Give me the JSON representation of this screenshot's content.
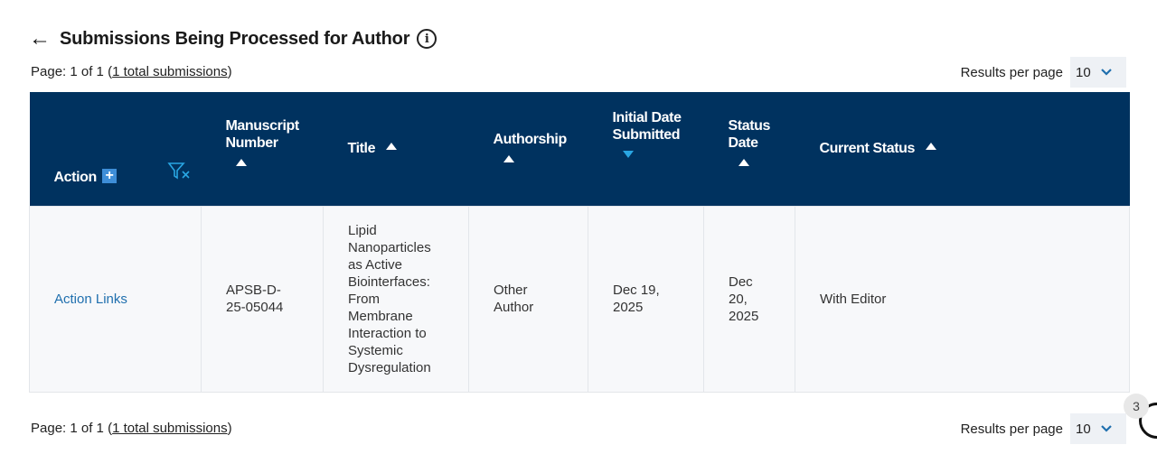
{
  "header": {
    "title": "Submissions Being Processed for Author",
    "back_icon": "←",
    "info_icon": "i"
  },
  "pager_top": {
    "prefix": "Page: 1 of 1 (",
    "link": "1 total submissions",
    "suffix": ")",
    "rpp_label": "Results per page",
    "rpp_value": "10"
  },
  "pager_bottom": {
    "prefix": "Page: 1 of 1 (",
    "link": "1 total submissions",
    "suffix": ")",
    "rpp_label": "Results per page",
    "rpp_value": "10"
  },
  "table": {
    "columns": {
      "action": "Action",
      "manuscript": "Manuscript Number",
      "title": "Title",
      "authorship": "Authorship",
      "initial_date": "Initial Date Submitted",
      "status_date": "Status Date",
      "current_status": "Current Status"
    },
    "rows": [
      {
        "action": "Action Links",
        "manuscript": "APSB-D-25-05044",
        "title": "Lipid Nanoparticles as Active Biointerfaces: From Membrane Interaction to Systemic Dysregulation",
        "authorship": "Other Author",
        "initial_date": "Dec 19, 2025",
        "status_date": "Dec 20, 2025",
        "current_status": "With Editor"
      }
    ]
  },
  "badge": {
    "count": "3"
  },
  "colors": {
    "header_bg": "#00325f",
    "link": "#1f6fae",
    "sort_active": "#29a6e3",
    "plus": "#3e8ed8"
  }
}
